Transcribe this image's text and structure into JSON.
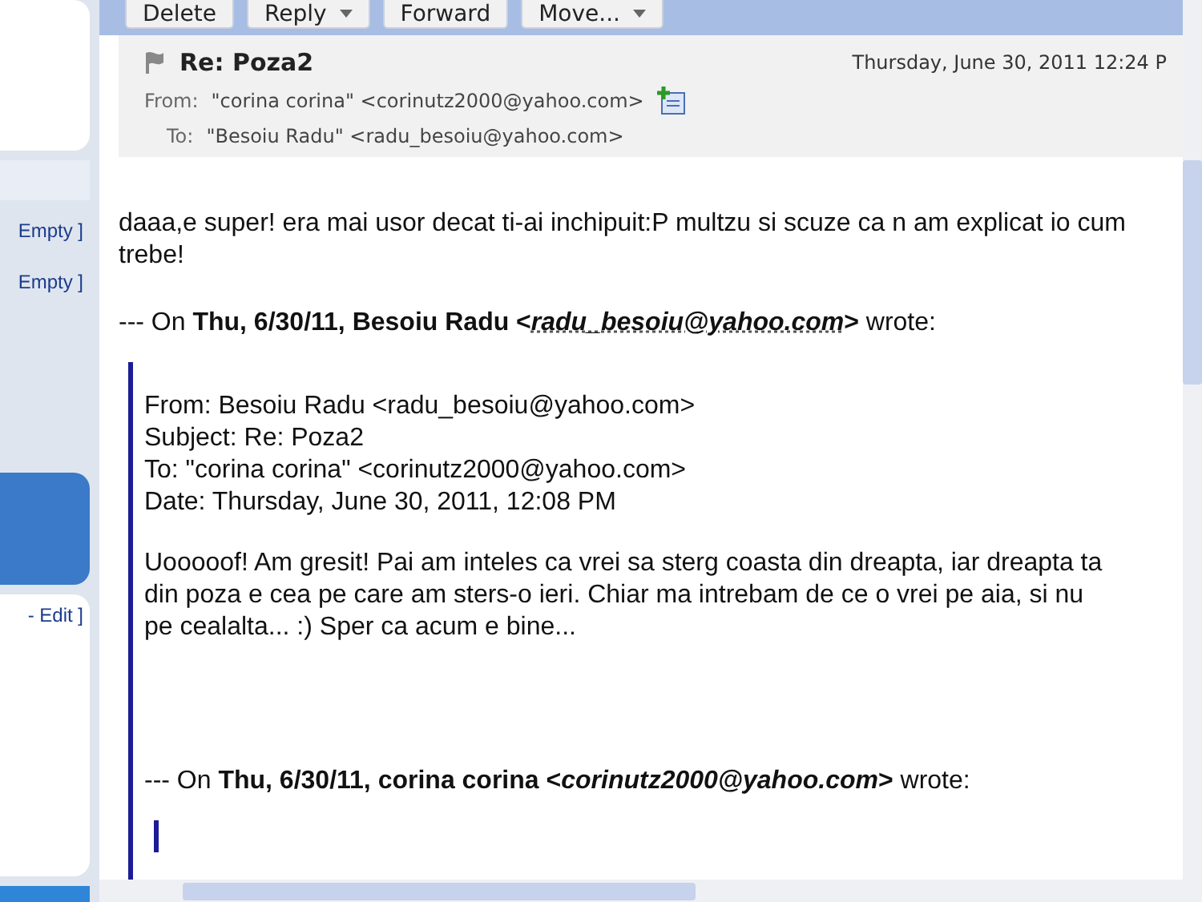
{
  "sidebar": {
    "folder_rows": [
      {
        "label": "Empty ]"
      },
      {
        "label": "Empty ]"
      }
    ],
    "edit_link": "- Edit ]"
  },
  "toolbar": {
    "buttons": [
      {
        "label": "Delete",
        "has_menu": false
      },
      {
        "label": "Reply",
        "has_menu": true
      },
      {
        "label": "Forward",
        "has_menu": false
      },
      {
        "label": "Move...",
        "has_menu": true
      }
    ]
  },
  "message": {
    "flagged": false,
    "subject": "Re: Poza2",
    "date": "Thursday, June 30, 2011 12:24 P",
    "from_label": "From:",
    "from": "\"corina corina\" <corinutz2000@yahoo.com>",
    "to_label": "To:",
    "to": "\"Besoiu Radu\" <radu_besoiu@yahoo.com>",
    "body": "daaa,e super! era mai usor decat ti-ai inchipuit:P multzu si scuze ca n am explicat io cum trebe!",
    "attribution": {
      "prefix": "--- On **Thu, 6/30/11, Besoiu Radu <**",
      "email": "radu_besoiu@yahoo.com",
      "email_is_link": true,
      "suffix": "**>** wrote:"
    },
    "quoted": {
      "headers": [
        "From: Besoiu Radu <radu_besoiu@yahoo.com>",
        "Subject: Re: Poza2",
        "To: \"corina corina\" <corinutz2000@yahoo.com>",
        "Date: Thursday, June 30, 2011, 12:08 PM"
      ],
      "body": "Uooooof! Am gresit! Pai am inteles ca vrei sa sterg coasta din dreapta, iar dreapta ta din poza e cea pe care am sters-o ieri. Chiar ma intrebam de ce o vrei pe aia, si nu pe cealalta... :) Sper ca acum e bine...",
      "attribution": {
        "prefix": "--- On **Thu, 6/30/11, corina corina <**",
        "email": "corinutz2000@yahoo.com",
        "email_is_link": false,
        "suffix": "**>** wrote:"
      }
    }
  }
}
